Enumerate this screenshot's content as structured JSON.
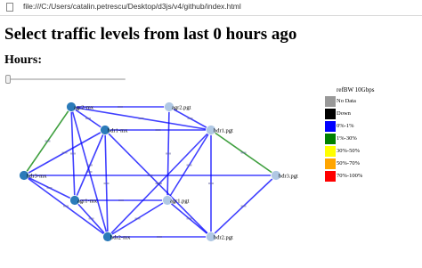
{
  "browser": {
    "url": "file:///C:/Users/catalin.petrescu/Desktop/d3js/v4/github/index.html"
  },
  "page": {
    "title": "Select traffic levels from last 0 hours ago",
    "hours_label": "Hours:"
  },
  "slider": {
    "value": 0
  },
  "legend": {
    "title": "refBW 10Gbps",
    "items": [
      {
        "label": "No Data",
        "color": "#999999"
      },
      {
        "label": "Down",
        "color": "#000000"
      },
      {
        "label": "0%-1%",
        "color": "#0000ff"
      },
      {
        "label": "1%-30%",
        "color": "#008000"
      },
      {
        "label": "30%-50%",
        "color": "#ffff00"
      },
      {
        "label": "50%-70%",
        "color": "#ffa500"
      },
      {
        "label": "70%-100%",
        "color": "#ff0000"
      }
    ]
  },
  "nodes": [
    {
      "id": "n1",
      "label": "agr2-mx",
      "color": "#2b7bb9"
    },
    {
      "id": "n2",
      "label": "agr2.pgt",
      "color": "#b0c8e4"
    },
    {
      "id": "n3",
      "label": "bdr1-mx",
      "color": "#2b7bb9"
    },
    {
      "id": "n4",
      "label": "bdr1.pgt",
      "color": "#b0c8e4"
    },
    {
      "id": "n5",
      "label": "bdr3-mx",
      "color": "#2b7bb9"
    },
    {
      "id": "n6",
      "label": "bdr3.pgt",
      "color": "#b0c8e4"
    },
    {
      "id": "n7",
      "label": "agr1-mx",
      "color": "#2b7bb9"
    },
    {
      "id": "n8",
      "label": "agr1.pgt",
      "color": "#b0c8e4"
    },
    {
      "id": "n9",
      "label": "bdr2-mx",
      "color": "#2b7bb9"
    },
    {
      "id": "n10",
      "label": "bdr2.pgt",
      "color": "#b0c8e4"
    }
  ],
  "links": [
    {
      "s": "n1",
      "t": "n2",
      "color": "#0000ff"
    },
    {
      "s": "n1",
      "t": "n3",
      "color": "#0000ff"
    },
    {
      "s": "n1",
      "t": "n5",
      "color": "#008000"
    },
    {
      "s": "n1",
      "t": "n7",
      "color": "#0000ff"
    },
    {
      "s": "n1",
      "t": "n9",
      "color": "#0000ff"
    },
    {
      "s": "n1",
      "t": "n4",
      "color": "#0000ff"
    },
    {
      "s": "n2",
      "t": "n4",
      "color": "#0000ff"
    },
    {
      "s": "n2",
      "t": "n8",
      "color": "#0000ff"
    },
    {
      "s": "n3",
      "t": "n4",
      "color": "#0000ff"
    },
    {
      "s": "n3",
      "t": "n5",
      "color": "#0000ff"
    },
    {
      "s": "n3",
      "t": "n7",
      "color": "#0000ff"
    },
    {
      "s": "n3",
      "t": "n9",
      "color": "#0000ff"
    },
    {
      "s": "n3",
      "t": "n10",
      "color": "#0000ff"
    },
    {
      "s": "n4",
      "t": "n6",
      "color": "#008000"
    },
    {
      "s": "n4",
      "t": "n8",
      "color": "#0000ff"
    },
    {
      "s": "n4",
      "t": "n10",
      "color": "#0000ff"
    },
    {
      "s": "n4",
      "t": "n9",
      "color": "#0000ff"
    },
    {
      "s": "n5",
      "t": "n6",
      "color": "#0000ff"
    },
    {
      "s": "n5",
      "t": "n7",
      "color": "#0000ff"
    },
    {
      "s": "n5",
      "t": "n9",
      "color": "#0000ff"
    },
    {
      "s": "n6",
      "t": "n10",
      "color": "#0000ff"
    },
    {
      "s": "n7",
      "t": "n8",
      "color": "#0000ff"
    },
    {
      "s": "n7",
      "t": "n9",
      "color": "#0000ff"
    },
    {
      "s": "n8",
      "t": "n10",
      "color": "#0000ff"
    },
    {
      "s": "n9",
      "t": "n10",
      "color": "#0000ff"
    },
    {
      "s": "n9",
      "t": "n8",
      "color": "#0000ff"
    }
  ]
}
